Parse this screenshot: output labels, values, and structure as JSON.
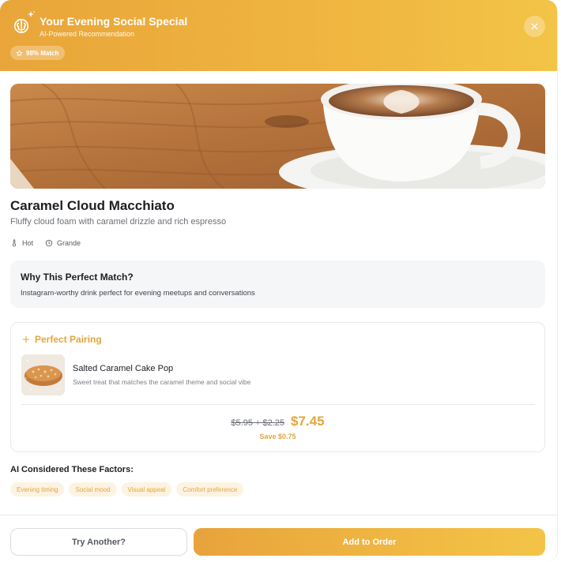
{
  "header": {
    "title": "Your Evening Social Special",
    "subtitle": "AI-Powered Recommendation",
    "match_badge": "98% Match",
    "brand_icon": "brain-icon",
    "sparkle_icon": "sparkle-icon",
    "close_icon": "close-icon",
    "gradient": [
      "#e9a53a",
      "#f3c447"
    ]
  },
  "product": {
    "name": "Caramel Cloud Macchiato",
    "description": "Fluffy cloud foam with caramel drizzle and rich espresso",
    "temperature": "Hot",
    "size": "Grande",
    "temperature_icon": "thermometer-icon",
    "size_icon": "clock-icon"
  },
  "why": {
    "title": "Why This Perfect Match?",
    "text": "Instagram-worthy drink perfect for evening meetups and conversations"
  },
  "pairing": {
    "heading": "Perfect Pairing",
    "heading_icon": "plus-icon",
    "item_name": "Salted Caramel Cake Pop",
    "item_description": "Sweet treat that matches the caramel theme and social vibe",
    "old_price": "$5.95 + $2.25",
    "new_price": "$7.45",
    "save_text": "Save $0.75"
  },
  "factors": {
    "title": "AI Considered These Factors:",
    "chips": [
      "Evening timing",
      "Social mood",
      "Visual appeal",
      "Comfort preference"
    ]
  },
  "actions": {
    "secondary": "Try Another?",
    "primary": "Add to Order"
  },
  "colors": {
    "accent": "#e3a53c",
    "chip_bg": "#fdf3e2"
  }
}
